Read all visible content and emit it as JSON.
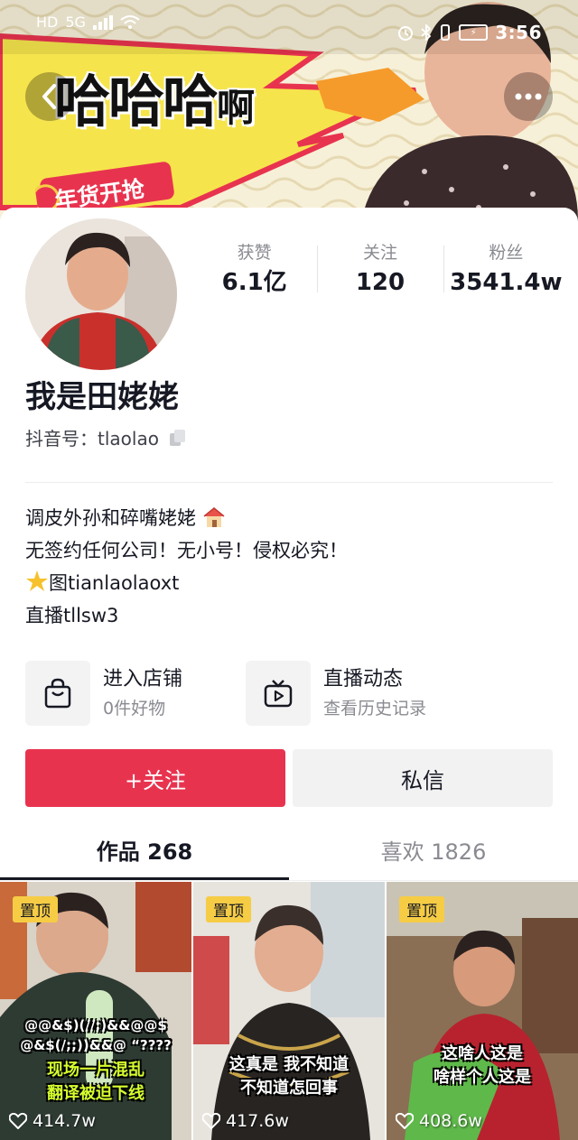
{
  "status_bar": {
    "left_icons": [
      "HD",
      "5G",
      "signal-icon",
      "wifi-icon"
    ],
    "time": "3:56"
  },
  "banner": {
    "title_big": "哈哈哈",
    "title_small": "啊",
    "badge": "年货开抢"
  },
  "profile": {
    "nickname": "我是田姥姥",
    "douyin_id_label": "抖音号：",
    "douyin_id": "tlaolao",
    "stats": [
      {
        "label": "获赞",
        "value": "6.1亿"
      },
      {
        "label": "关注",
        "value": "120"
      },
      {
        "label": "粉丝",
        "value": "3541.4w"
      }
    ],
    "bio": [
      "调皮外孙和碎嘴姥姥",
      "无签约任何公司！无小号！侵权必究！",
      "图tianlaolaoxt",
      "直播tllsw3"
    ]
  },
  "cards": {
    "shop": {
      "title": "进入店铺",
      "subtitle": "0件好物"
    },
    "live": {
      "title": "直播动态",
      "subtitle": "查看历史记录"
    }
  },
  "actions": {
    "follow": "+关注",
    "message": "私信"
  },
  "tabs": {
    "works": "作品 268",
    "likes": "喜欢 1826"
  },
  "videos": [
    {
      "pin": "置顶",
      "caption_small": "@@&$)(//;)&&@@$",
      "caption_small2": "@&$(/;;))&&@ “????",
      "caption1": "现场一片混乱",
      "caption2": "翻译被迫下线",
      "likes": "414.7w"
    },
    {
      "pin": "置顶",
      "caption1": "这真是 我不知道",
      "caption2": "不知道怎回事",
      "likes": "417.6w"
    },
    {
      "pin": "置顶",
      "caption1": "这啥人这是",
      "caption2": "啥样个人这是",
      "likes": "408.6w"
    }
  ],
  "colors": {
    "accent": "#e8334f",
    "pin_badge": "#f6cc45",
    "banner_yellow": "#f6e44c"
  }
}
